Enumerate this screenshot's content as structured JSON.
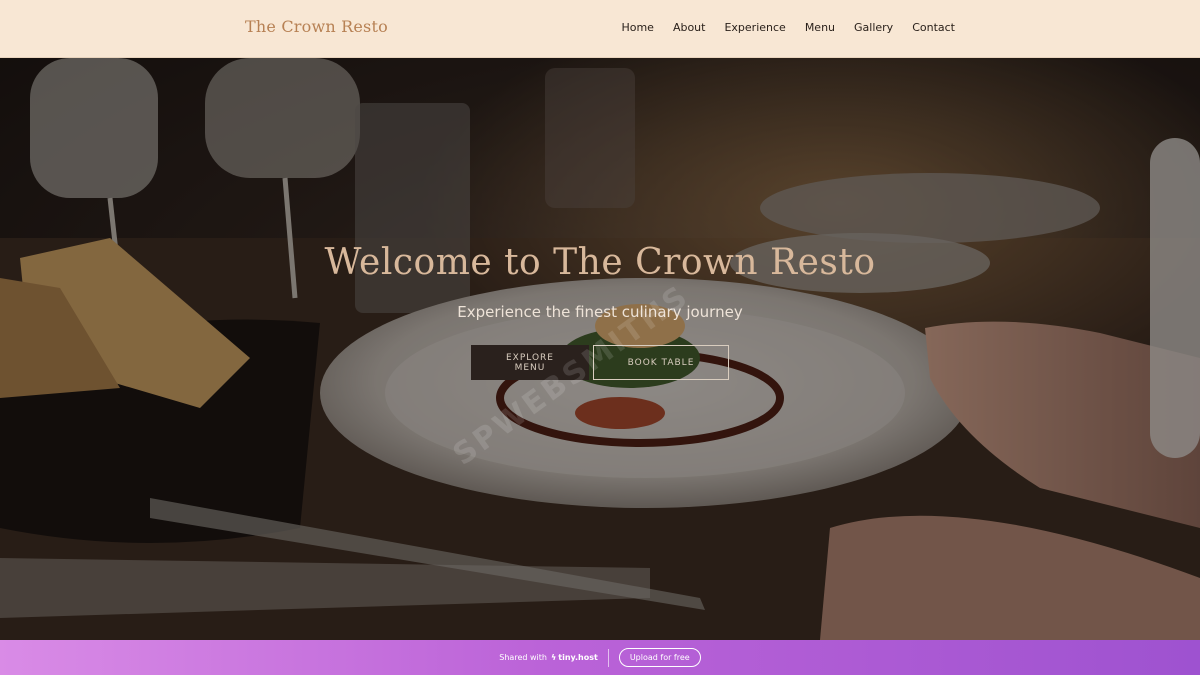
{
  "header": {
    "logo": "The Crown Resto",
    "nav": [
      "Home",
      "About",
      "Experience",
      "Menu",
      "Gallery",
      "Contact"
    ]
  },
  "hero": {
    "title": "Welcome to The Crown Resto",
    "subtitle": "Experience the finest culinary journey",
    "primary_button": "EXPLORE MENU",
    "secondary_button": "BOOK TABLE",
    "watermark": "SPWEBSMITHS"
  },
  "footer": {
    "shared_with": "Shared with",
    "brand": "tiny.host",
    "brand_icon": "lightning-icon",
    "upload_label": "Upload for free"
  },
  "colors": {
    "header_bg": "#f8e7d4",
    "logo": "#b78154",
    "title": "#d8b89b",
    "button_dark": "#2a211d",
    "footer_gradient_start": "#d98be6",
    "footer_gradient_end": "#9e52d0"
  }
}
